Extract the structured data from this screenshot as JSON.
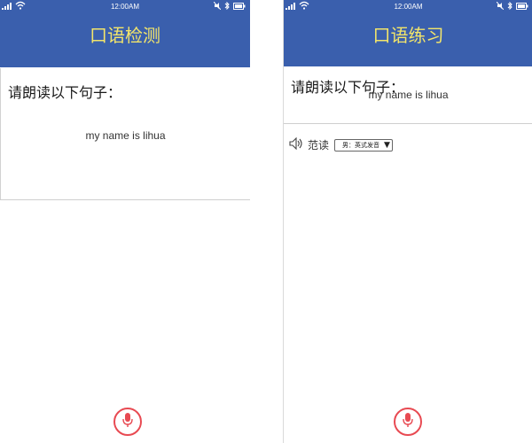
{
  "left": {
    "status": {
      "time": "12:00AM"
    },
    "header": {
      "title": "口语检测"
    },
    "prompt": "请朗读以下句子：",
    "sentence": "my name is lihua"
  },
  "right": {
    "status": {
      "time": "12:00AM"
    },
    "header": {
      "title": "口语练习"
    },
    "prompt": "请朗读以下句子：",
    "sentence": "my name is lihua",
    "sample": {
      "label": "范读",
      "selected": "男：英式发音"
    }
  },
  "colors": {
    "header_bg": "#3a5fad",
    "header_text": "#f3e56a",
    "mic_red": "#e84a52"
  },
  "icons": [
    "signal-icon",
    "wifi-icon",
    "mute-icon",
    "bluetooth-icon",
    "battery-icon",
    "speaker-icon",
    "microphone-icon"
  ]
}
